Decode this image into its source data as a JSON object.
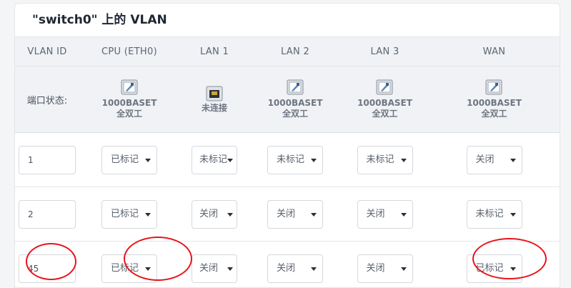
{
  "panel": {
    "title": "\"switch0\" 上的 VLAN"
  },
  "columns": [
    "VLAN ID",
    "CPU (ETH0)",
    "LAN 1",
    "LAN 2",
    "LAN 3",
    "WAN"
  ],
  "status": {
    "label": "端口状态:",
    "ports": [
      {
        "icon": "ethernet-connected-icon",
        "line1": "1000BASET",
        "line2": "全双工"
      },
      {
        "icon": "ethernet-disconnected-icon",
        "line1": "",
        "line2": "未连接"
      },
      {
        "icon": "ethernet-connected-icon",
        "line1": "1000BASET",
        "line2": "全双工"
      },
      {
        "icon": "ethernet-connected-icon",
        "line1": "1000BASET",
        "line2": "全双工"
      },
      {
        "icon": "ethernet-connected-icon",
        "line1": "1000BASET",
        "line2": "全双工"
      }
    ]
  },
  "rows": [
    {
      "vlan_id": "1",
      "ports": [
        "已标记",
        "未标记",
        "未标记",
        "未标记",
        "关闭"
      ]
    },
    {
      "vlan_id": "2",
      "ports": [
        "已标记",
        "关闭",
        "关闭",
        "关闭",
        "未标记"
      ]
    },
    {
      "vlan_id": "45",
      "ports": [
        "已标记",
        "关闭",
        "关闭",
        "关闭",
        "已标记"
      ]
    }
  ],
  "colors": {
    "highlight": "#e8141b",
    "header_bg": "#f0f2f5"
  }
}
